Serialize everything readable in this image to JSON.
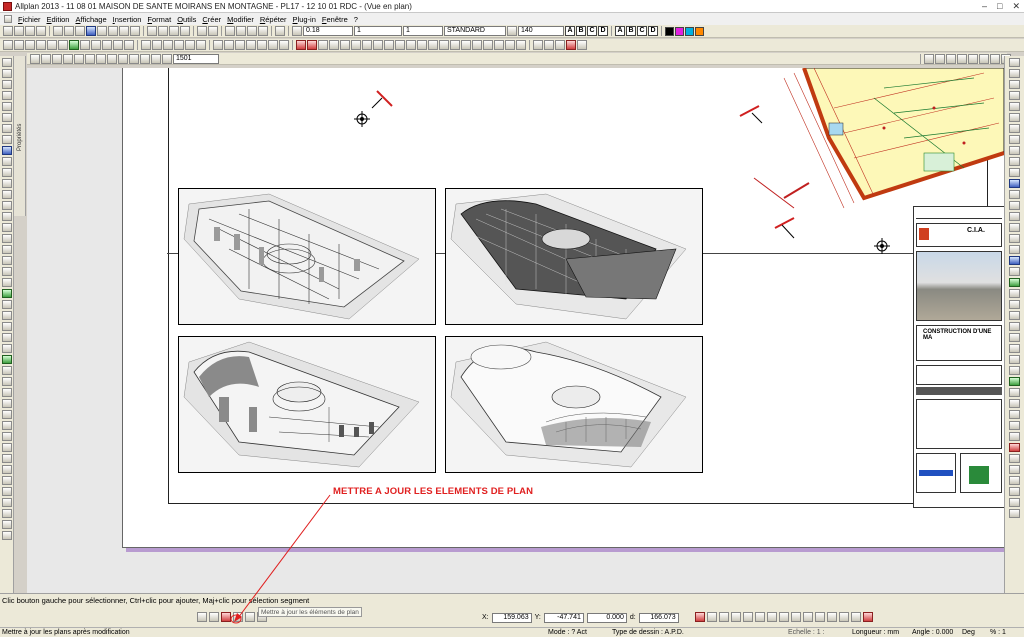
{
  "window": {
    "title": "Allplan 2013 - 11 08 01 MAISON DE SANTE MOIRANS EN MONTAGNE - PL17 - 12 10 01 RDC - (Vue en plan)",
    "minimize": "–",
    "maximize": "□",
    "close": "✕"
  },
  "menu": {
    "items": [
      "Fichier",
      "Edition",
      "Affichage",
      "Insertion",
      "Format",
      "Outils",
      "Créer",
      "Modifier",
      "Répéter",
      "Plug-in",
      "Fenêtre",
      "?"
    ]
  },
  "toolbar": {
    "pen_thickness": "0.18",
    "line_type": "1",
    "line_color": "1",
    "layer": "STANDARD",
    "text_height": "140",
    "fill_colors": [
      "#000000",
      "#e020e0",
      "#00b0e0",
      "#ff8800"
    ]
  },
  "toolbar3": {
    "scale_input": "1501"
  },
  "left_panel": {
    "properties_tab": "Propriétés"
  },
  "canvas": {
    "annotation": "METTRE A JOUR LES ELEMENTS DE PLAN",
    "annotation_color": "#e02020"
  },
  "titleblock": {
    "company": "C.I.A.",
    "project": "CONSTRUCTION D'UNE MA"
  },
  "status": {
    "hint": "Clic bouton gauche pour sélectionner, Ctrl+clic pour ajouter, Maj+clic pour sélection segment",
    "tooltip": "Mettre à jour les éléments de plan",
    "coord_x_label": "X:",
    "coord_x": "159.063",
    "coord_y_label": "Y:",
    "coord_y": "-47.741",
    "coord_z_label": "",
    "coord_z": "0.000",
    "coord_d_label": "d:",
    "coord_d": "166.073",
    "bottom_message": "Mettre à jour les plans après modification",
    "mode": "Mode : ? Act",
    "drawing_type": "Type de dessin : A.P.D.",
    "scale": "Echelle : 1 :",
    "length_unit": "Longueur : mm",
    "angle": "Angle : 0.000",
    "angle_unit": "Deg",
    "percent": "% : 1"
  }
}
